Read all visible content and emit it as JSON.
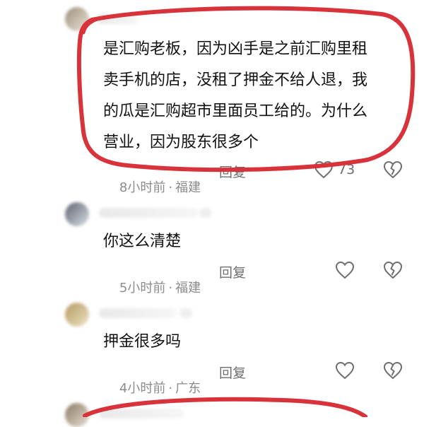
{
  "comments": [
    {
      "lines": [
        "是汇购老板，因为凶手是之前汇购里租",
        "卖手机的店，没租了押金不给人退，我",
        "的瓜是汇购超市里面员工给的。为什么",
        "营业，因为股东很多个"
      ],
      "time": "8小时前",
      "location": "福建",
      "reply_label": "回复",
      "like_count": "73",
      "highlighted": true
    },
    {
      "lines": [
        "你这么清楚"
      ],
      "time": "5小时前",
      "location": "福建",
      "reply_label": "回复",
      "like_count": ""
    },
    {
      "lines": [
        "押金很多吗"
      ],
      "time": "4小时前",
      "location": "广东",
      "reply_label": "回复",
      "like_count": ""
    }
  ],
  "separator": "·",
  "icons": {
    "like": "heart-icon",
    "dislike": "broken-heart-icon"
  },
  "colors": {
    "highlight_stroke": "#d8333a",
    "meta_text": "#8c8c8c",
    "body_text": "#111111"
  }
}
